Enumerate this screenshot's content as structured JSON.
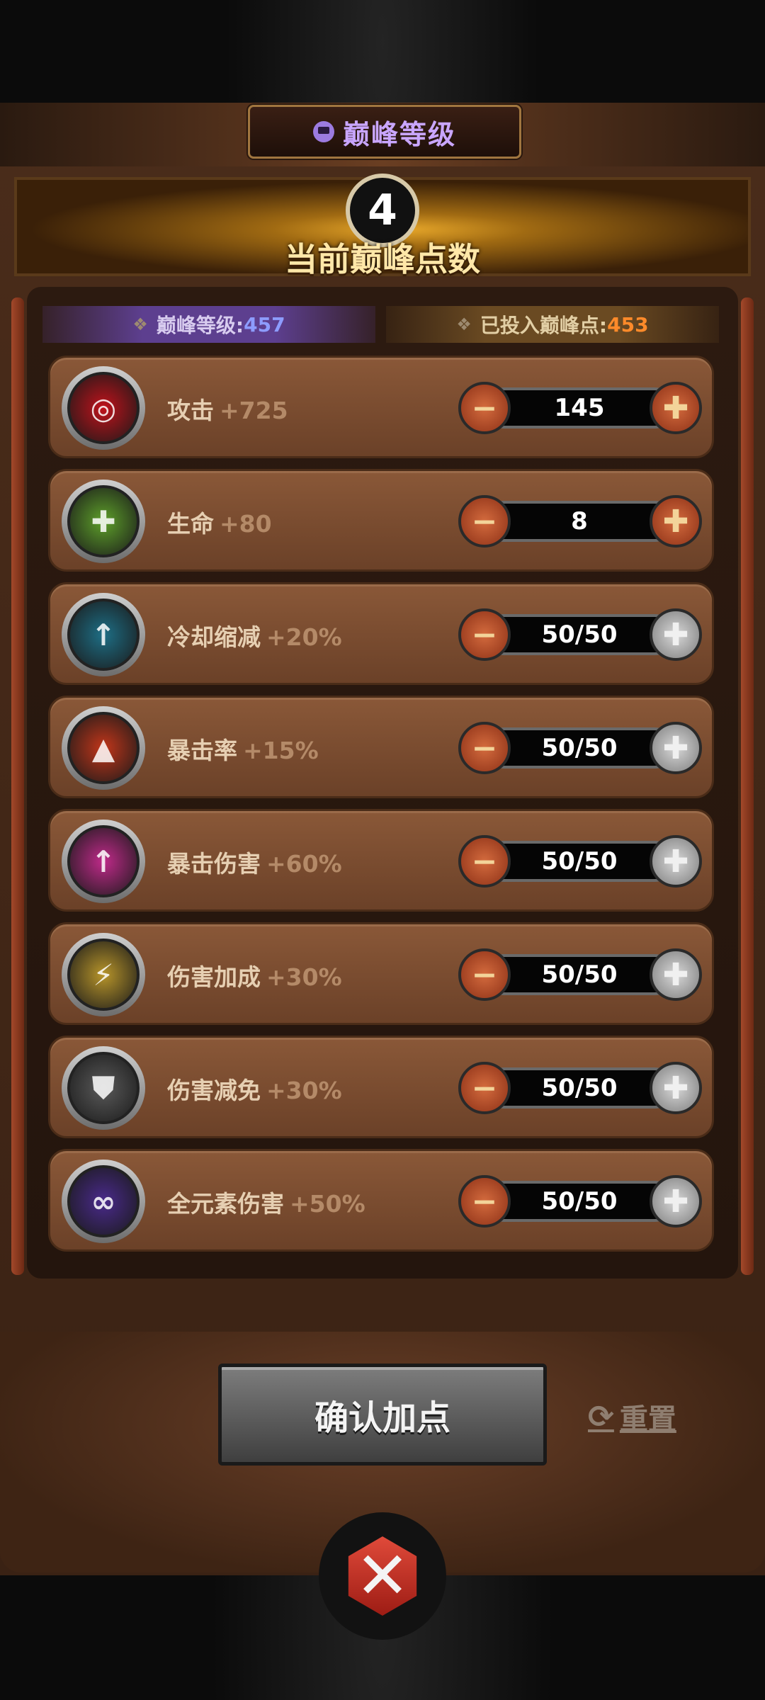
{
  "header": {
    "title": "巅峰等级"
  },
  "banner": {
    "points": "4",
    "label": "当前巅峰点数"
  },
  "stats": {
    "level_label": "巅峰等级:",
    "level_value": "457",
    "invested_label": "已投入巅峰点:",
    "invested_value": "453"
  },
  "rows": [
    {
      "name": "攻击",
      "bonus": "+725",
      "value": "145",
      "icon": "attack-target-icon",
      "color": "#c0121b",
      "plus_enabled": true
    },
    {
      "name": "生命",
      "bonus": "+80",
      "value": "8",
      "icon": "life-leaf-icon",
      "color": "#5ea02a",
      "plus_enabled": true
    },
    {
      "name": "冷却缩减",
      "bonus": "+20%",
      "value": "50/50",
      "icon": "cooldown-clock-icon",
      "color": "#1e6f86",
      "plus_enabled": false
    },
    {
      "name": "暴击率",
      "bonus": "+15%",
      "value": "50/50",
      "icon": "crit-flame-icon",
      "color": "#c2361a",
      "plus_enabled": false
    },
    {
      "name": "暴击伤害",
      "bonus": "+60%",
      "value": "50/50",
      "icon": "crit-damage-arrow-icon",
      "color": "#c02a8a",
      "plus_enabled": false
    },
    {
      "name": "伤害加成",
      "bonus": "+30%",
      "value": "50/50",
      "icon": "damage-bolt-icon",
      "color": "#b8952a",
      "plus_enabled": false
    },
    {
      "name": "伤害减免",
      "bonus": "+30%",
      "value": "50/50",
      "icon": "shield-reduction-icon",
      "color": "#5a5a5a",
      "plus_enabled": false
    },
    {
      "name": "全元素伤害",
      "bonus": "+50%",
      "value": "50/50",
      "icon": "element-orbs-icon",
      "color": "#4a2a8c",
      "plus_enabled": false
    }
  ],
  "actions": {
    "confirm_label": "确认加点",
    "reset_label": "重置"
  },
  "colors": {
    "accent_purple": "#c9a6ff",
    "level_blue": "#8d9cff",
    "invested_orange": "#ff8a2a",
    "button_red": "#8c3016"
  }
}
